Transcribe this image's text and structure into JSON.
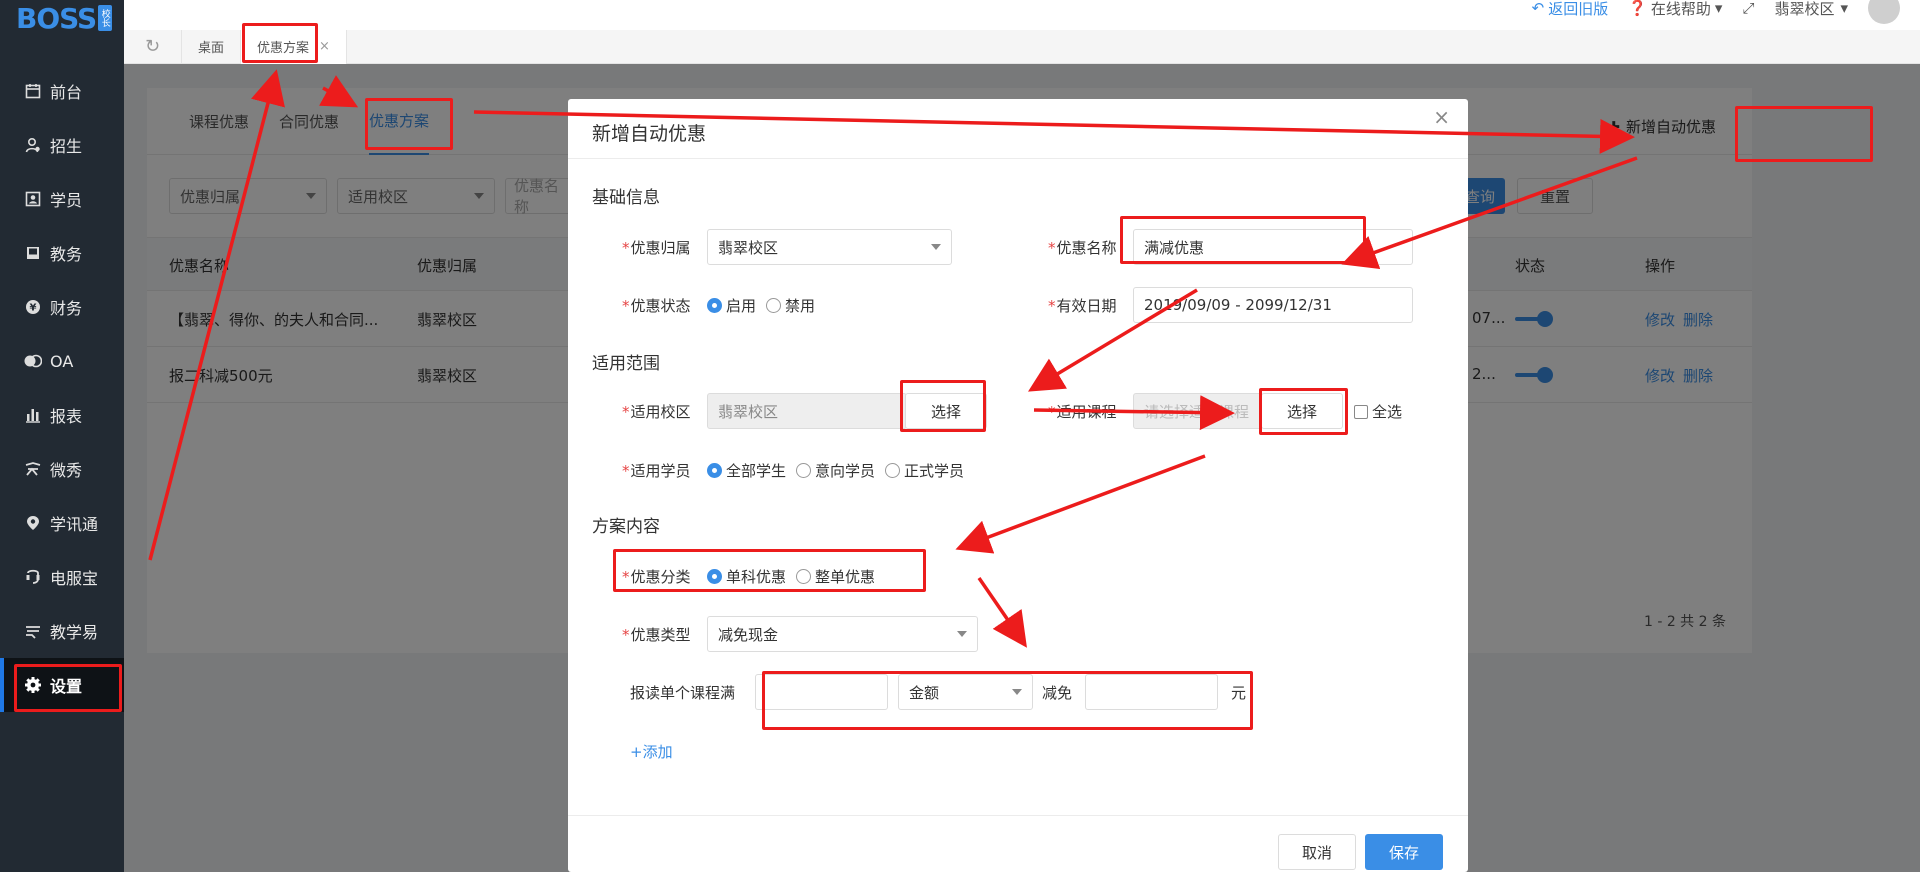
{
  "logo": {
    "text": "BOSS",
    "badge": "校长"
  },
  "sidebar": {
    "items": [
      {
        "label": "前台",
        "icon": "calendar-icon"
      },
      {
        "label": "招生",
        "icon": "user-add-icon"
      },
      {
        "label": "学员",
        "icon": "id-card-icon"
      },
      {
        "label": "教务",
        "icon": "book-icon"
      },
      {
        "label": "财务",
        "icon": "yen-icon"
      },
      {
        "label": "OA",
        "icon": "oa-icon"
      },
      {
        "label": "报表",
        "icon": "bar-chart-icon"
      },
      {
        "label": "微秀",
        "icon": "wei-xiu-icon"
      },
      {
        "label": "学讯通",
        "icon": "location-icon"
      },
      {
        "label": "电服宝",
        "icon": "phone-service-icon"
      },
      {
        "label": "教学易",
        "icon": "teach-icon"
      },
      {
        "label": "设置",
        "icon": "gear-icon",
        "active": true
      }
    ]
  },
  "topbar": {
    "back_old": "返回旧版",
    "help": "在线帮助",
    "campus": "翡翠校区"
  },
  "page_tabs": [
    {
      "label": "桌面"
    },
    {
      "label": "优惠方案",
      "active": true,
      "close": "×"
    }
  ],
  "main": {
    "subtabs": [
      "课程优惠",
      "合同优惠",
      "优惠方案"
    ],
    "active_subtab": "优惠方案",
    "add_button": "新增自动优惠",
    "filters": {
      "belong_placeholder": "优惠归属",
      "campus_placeholder": "适用校区",
      "name_placeholder": "优惠名称"
    },
    "query_btn": "查询",
    "reset_btn": "重置",
    "columns": [
      "优惠名称",
      "优惠归属",
      "状态",
      "操作"
    ],
    "rows": [
      {
        "name": "【翡翠、得你、的夫人和合同...",
        "belong": "翡翠校区",
        "date_tail": "07...",
        "status_on": true,
        "edit": "修改",
        "delete": "删除"
      },
      {
        "name": "报二科减500元",
        "belong": "翡翠校区",
        "date_tail": "2...",
        "status_on": true,
        "edit": "修改",
        "delete": "删除"
      }
    ],
    "pagination": "1 - 2    共 2 条"
  },
  "modal": {
    "title": "新增自动优惠",
    "close": "×",
    "sections": {
      "basic": "基础信息",
      "scope": "适用范围",
      "content": "方案内容"
    },
    "fields": {
      "belong_label": "优惠归属",
      "belong_value": "翡翠校区",
      "name_label": "优惠名称",
      "name_value": "满减优惠",
      "status_label": "优惠状态",
      "status_options": [
        "启用",
        "禁用"
      ],
      "status_selected": "启用",
      "date_label": "有效日期",
      "date_value": "2019/09/09 - 2099/12/31",
      "campus_label": "适用校区",
      "campus_value": "翡翠校区",
      "campus_btn": "选择",
      "course_label": "适用课程",
      "course_placeholder": "请选择适应课程",
      "course_btn": "选择",
      "select_all": "全选",
      "student_label": "适用学员",
      "student_options": [
        "全部学生",
        "意向学员",
        "正式学员"
      ],
      "student_selected": "全部学生",
      "category_label": "优惠分类",
      "category_options": [
        "单科优惠",
        "整单优惠"
      ],
      "category_selected": "单科优惠",
      "type_label": "优惠类型",
      "type_value": "减免现金",
      "rule_prefix": "报读单个课程满",
      "rule_unit_select": "金额",
      "rule_reduce": "减免",
      "rule_suffix": "元",
      "add_link": "+添加"
    },
    "cancel": "取消",
    "save": "保存"
  },
  "colors": {
    "accent": "#3a8ee6",
    "sidebar_bg": "#222a33",
    "annotation_red": "#ec1c1c",
    "required": "#e64545"
  }
}
